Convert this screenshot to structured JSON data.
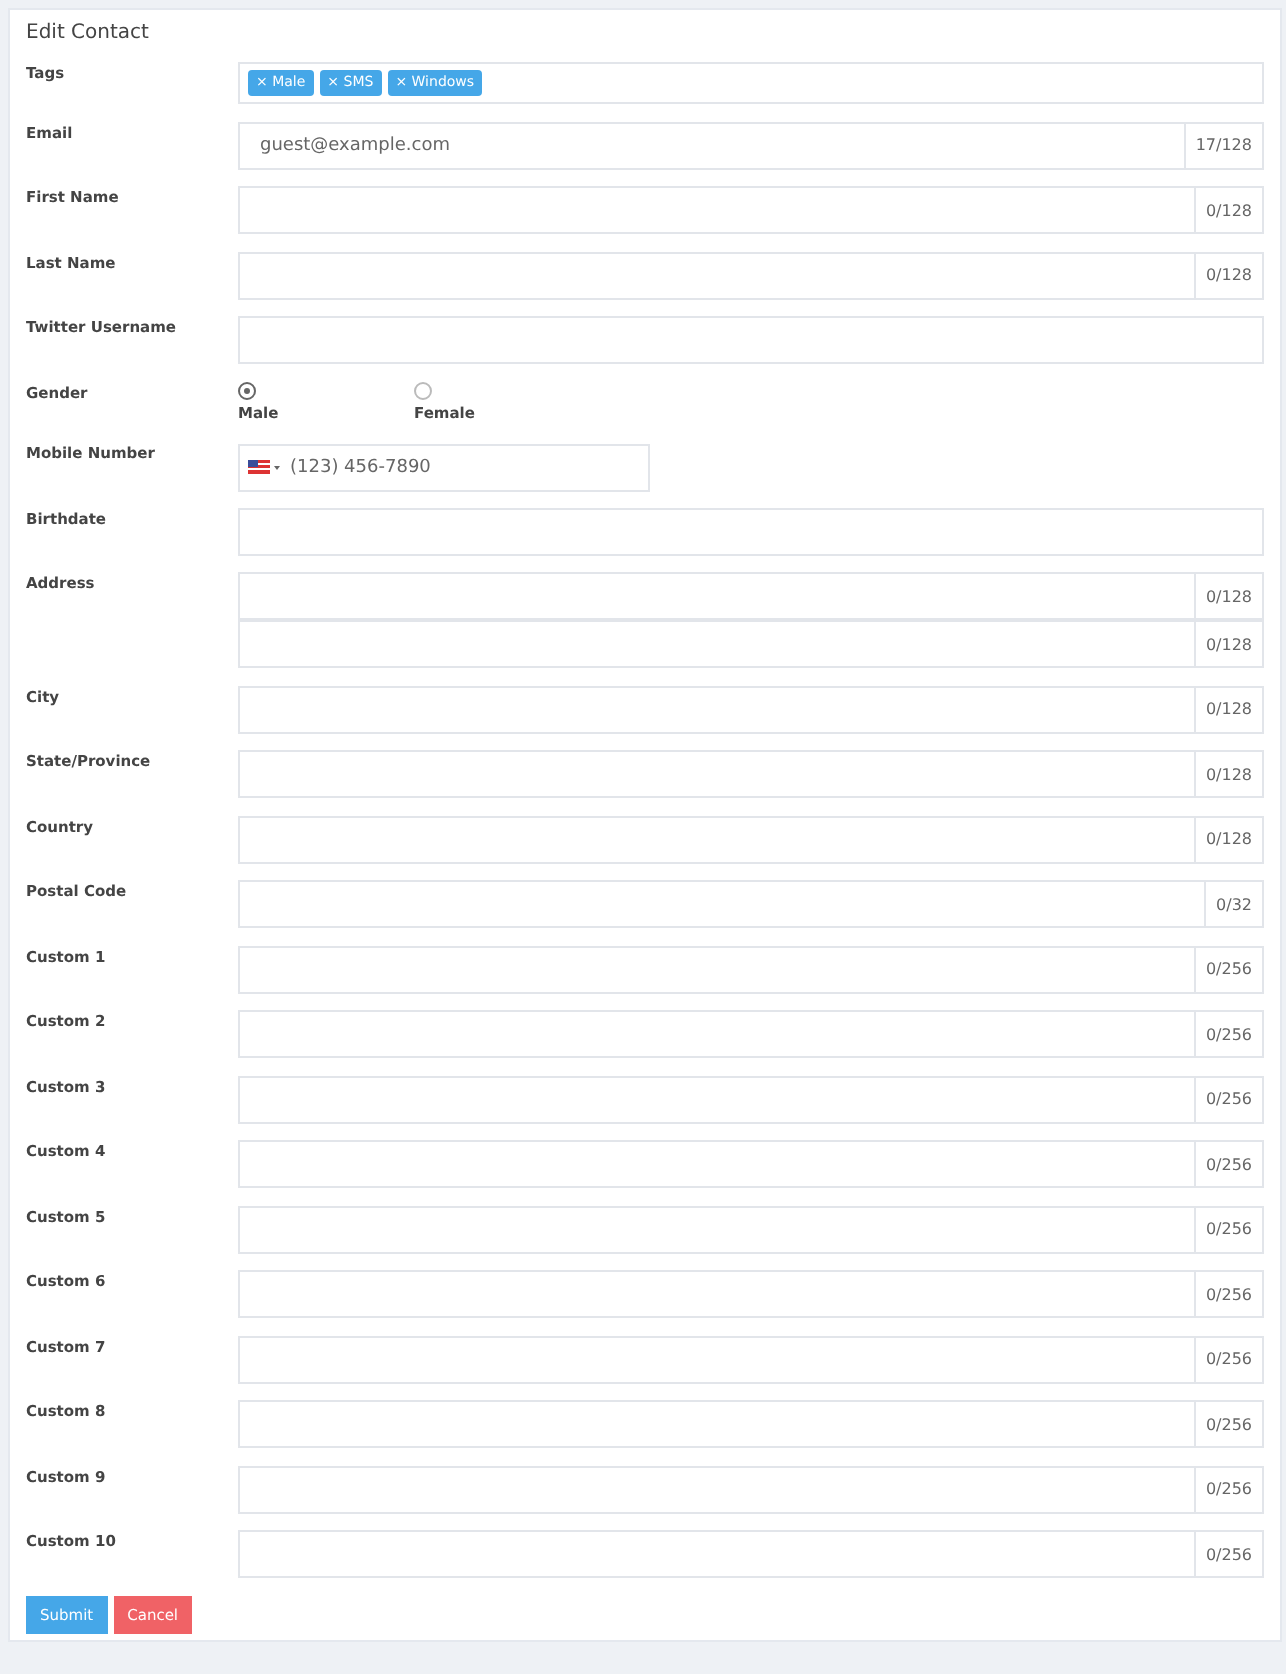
{
  "title": "Edit Contact",
  "fields": [
    {
      "kind": "tags",
      "label": "Tags",
      "tags": [
        "× Male",
        "× SMS",
        "× Windows"
      ]
    },
    {
      "kind": "text",
      "label": "Email",
      "value": "guest@example.com",
      "counter": "17/128"
    },
    {
      "kind": "text",
      "label": "First Name",
      "counter": "0/128"
    },
    {
      "kind": "text",
      "label": "Last Name",
      "counter": "0/128"
    },
    {
      "kind": "text",
      "label": "Twitter Username"
    },
    {
      "kind": "radio",
      "label": "Gender",
      "options": [
        {
          "label": "Male",
          "selected": true
        },
        {
          "label": "Female",
          "selected": false
        }
      ]
    },
    {
      "kind": "phone",
      "label": "Mobile Number",
      "placeholder": "(123) 456-7890"
    },
    {
      "kind": "text",
      "label": "Birthdate"
    },
    {
      "kind": "multi",
      "label": "Address",
      "counters": [
        "0/128",
        "0/128"
      ]
    },
    {
      "kind": "text",
      "label": "City",
      "counter": "0/128"
    },
    {
      "kind": "text",
      "label": "State/Province",
      "counter": "0/128"
    },
    {
      "kind": "text",
      "label": "Country",
      "counter": "0/128"
    },
    {
      "kind": "text",
      "label": "Postal Code",
      "counter": "0/32"
    },
    {
      "kind": "text",
      "label": "Custom 1",
      "counter": "0/256"
    },
    {
      "kind": "text",
      "label": "Custom 2",
      "counter": "0/256"
    },
    {
      "kind": "text",
      "label": "Custom 3",
      "counter": "0/256"
    },
    {
      "kind": "text",
      "label": "Custom 4",
      "counter": "0/256"
    },
    {
      "kind": "text",
      "label": "Custom 5",
      "counter": "0/256"
    },
    {
      "kind": "text",
      "label": "Custom 6",
      "counter": "0/256"
    },
    {
      "kind": "text",
      "label": "Custom 7",
      "counter": "0/256"
    },
    {
      "kind": "text",
      "label": "Custom 8",
      "counter": "0/256"
    },
    {
      "kind": "text",
      "label": "Custom 9",
      "counter": "0/256"
    },
    {
      "kind": "text",
      "label": "Custom 10",
      "counter": "0/256"
    }
  ],
  "buttons": [
    {
      "kind": "primary",
      "label": "Submit"
    },
    {
      "kind": "danger",
      "label": "Cancel"
    }
  ]
}
